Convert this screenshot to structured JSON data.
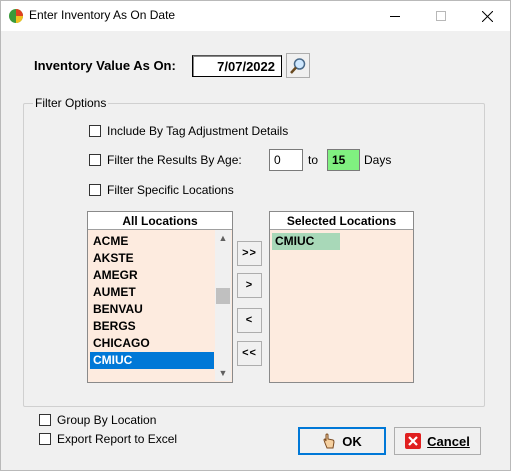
{
  "window": {
    "title": "Enter Inventory As On Date"
  },
  "inventory": {
    "label": "Inventory Value As On:",
    "date": "7/07/2022"
  },
  "filter_options": {
    "title": "Filter Options",
    "include_tag_label": "Include By Tag Adjustment Details",
    "filter_age_label": "Filter the Results By Age:",
    "age_from": "0",
    "to_label": "to",
    "age_to": "15",
    "days_label": "Days",
    "filter_locations_label": "Filter Specific Locations"
  },
  "all_locations": {
    "header": "All Locations",
    "items": [
      "ACME",
      "AKSTE",
      "AMEGR",
      "AUMET",
      "BENVAU",
      "BERGS",
      "CHICAGO",
      "CMIUC"
    ],
    "selected_index": 7
  },
  "selected_locations": {
    "header": "Selected Locations",
    "items": [
      "CMIUC"
    ]
  },
  "move_buttons": {
    "add_all": ">>",
    "add_one": ">",
    "remove_one": "<",
    "remove_all": "<<"
  },
  "options": {
    "group_by_location": "Group By Location",
    "export_excel": "Export Report to Excel"
  },
  "buttons": {
    "ok": "OK",
    "cancel": "Cancel"
  },
  "colors": {
    "list_bg": "#fdebdf",
    "selection": "#0078d7",
    "age_highlight": "#80f080",
    "selected_item": "#a8d8b8"
  }
}
